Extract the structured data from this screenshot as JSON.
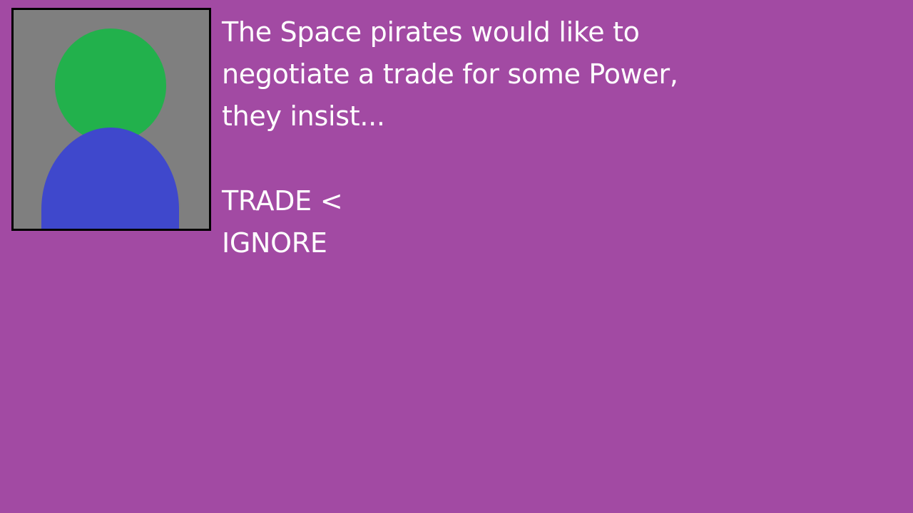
{
  "colors": {
    "background": "#a24aa3",
    "portrait_bg": "#7f7f7f",
    "portrait_border": "#000000",
    "head": "#22b14c",
    "body": "#3f48cc",
    "text": "#ffffff"
  },
  "portrait": {
    "icon": "npc-avatar-icon"
  },
  "dialog": {
    "lines": [
      "The Space pirates would like to",
      "negotiate a trade for some Power,",
      "they insist..."
    ]
  },
  "options": [
    {
      "label": "TRADE",
      "selected": true,
      "cursor": "<"
    },
    {
      "label": "IGNORE",
      "selected": false,
      "cursor": ""
    }
  ]
}
